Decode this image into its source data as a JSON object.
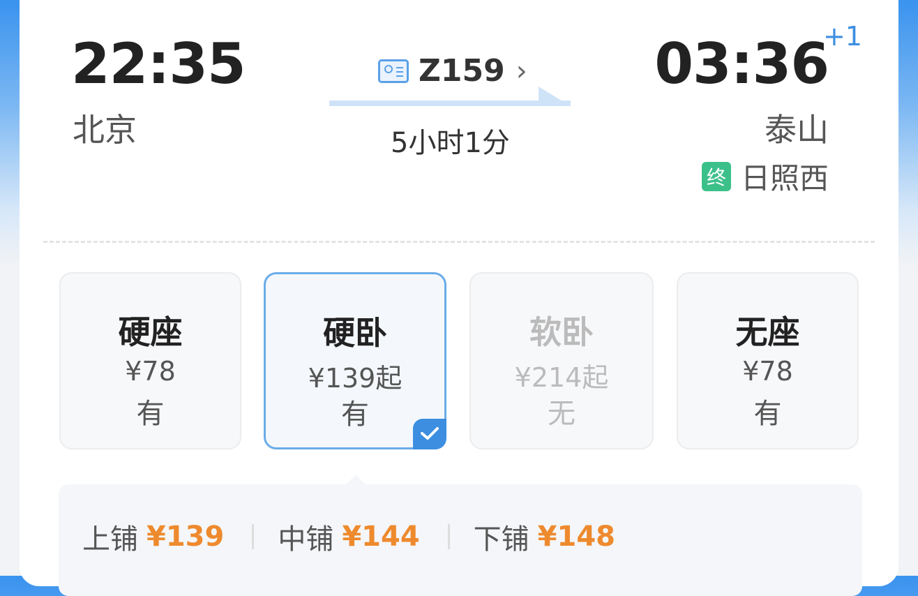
{
  "journey": {
    "depart_time": "22:35",
    "depart_station": "北京",
    "arrive_time": "03:36",
    "arrive_day_offset": "+1",
    "arrive_station": "泰山",
    "terminal_badge": "终",
    "terminal_station": "日照西",
    "train_number": "Z159",
    "duration": "5小时1分"
  },
  "seats": [
    {
      "name": "硬座",
      "price": "¥78",
      "availability": "有",
      "state": "normal"
    },
    {
      "name": "硬卧",
      "price": "¥139起",
      "availability": "有",
      "state": "selected"
    },
    {
      "name": "软卧",
      "price": "¥214起",
      "availability": "无",
      "state": "disabled"
    },
    {
      "name": "无座",
      "price": "¥78",
      "availability": "有",
      "state": "normal"
    }
  ],
  "berths": [
    {
      "label": "上铺",
      "price": "¥139"
    },
    {
      "label": "中铺",
      "price": "¥144"
    },
    {
      "label": "下铺",
      "price": "¥148"
    }
  ],
  "colors": {
    "accent": "#3d8ee0",
    "price_orange": "#ee8a2e",
    "terminal_green": "#3cc08a"
  },
  "icons": {
    "train_info": "id-card-icon",
    "chevron": "chevron-right-icon",
    "check": "checkmark-icon"
  }
}
